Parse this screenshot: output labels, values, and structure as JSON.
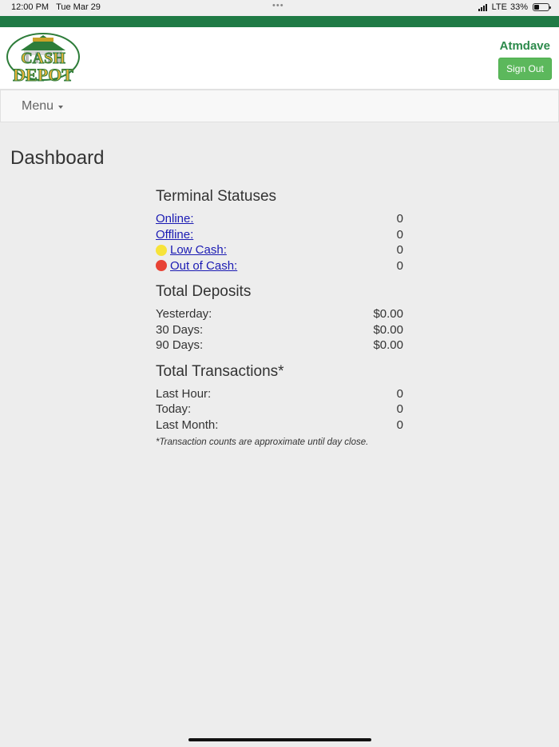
{
  "status_bar": {
    "time": "12:00 PM",
    "date": "Tue Mar 29",
    "network": "LTE",
    "battery": "33%",
    "dots": "•••"
  },
  "header": {
    "logo_alt": "Cash Depot",
    "username": "Atmdave",
    "sign_out_label": "Sign Out",
    "brand_color": "#1f7a45",
    "button_color": "#5cb85c"
  },
  "menu": {
    "label": "Menu"
  },
  "page": {
    "title": "Dashboard"
  },
  "terminal_statuses": {
    "title": "Terminal Statuses",
    "rows": [
      {
        "label": "Online:",
        "value": "0",
        "indicator": null
      },
      {
        "label": "Offline:",
        "value": "0",
        "indicator": null
      },
      {
        "label": "Low Cash:",
        "value": "0",
        "indicator": "yellow"
      },
      {
        "label": "Out of Cash:",
        "value": "0",
        "indicator": "red"
      }
    ]
  },
  "total_deposits": {
    "title": "Total Deposits",
    "rows": [
      {
        "label": "Yesterday:",
        "value": "$0.00"
      },
      {
        "label": "30 Days:",
        "value": "$0.00"
      },
      {
        "label": "90 Days:",
        "value": "$0.00"
      }
    ]
  },
  "total_transactions": {
    "title": "Total Transactions*",
    "rows": [
      {
        "label": "Last Hour:",
        "value": "0"
      },
      {
        "label": "Today:",
        "value": "0"
      },
      {
        "label": "Last Month:",
        "value": "0"
      }
    ],
    "note": "*Transaction counts are approximate until day close."
  }
}
